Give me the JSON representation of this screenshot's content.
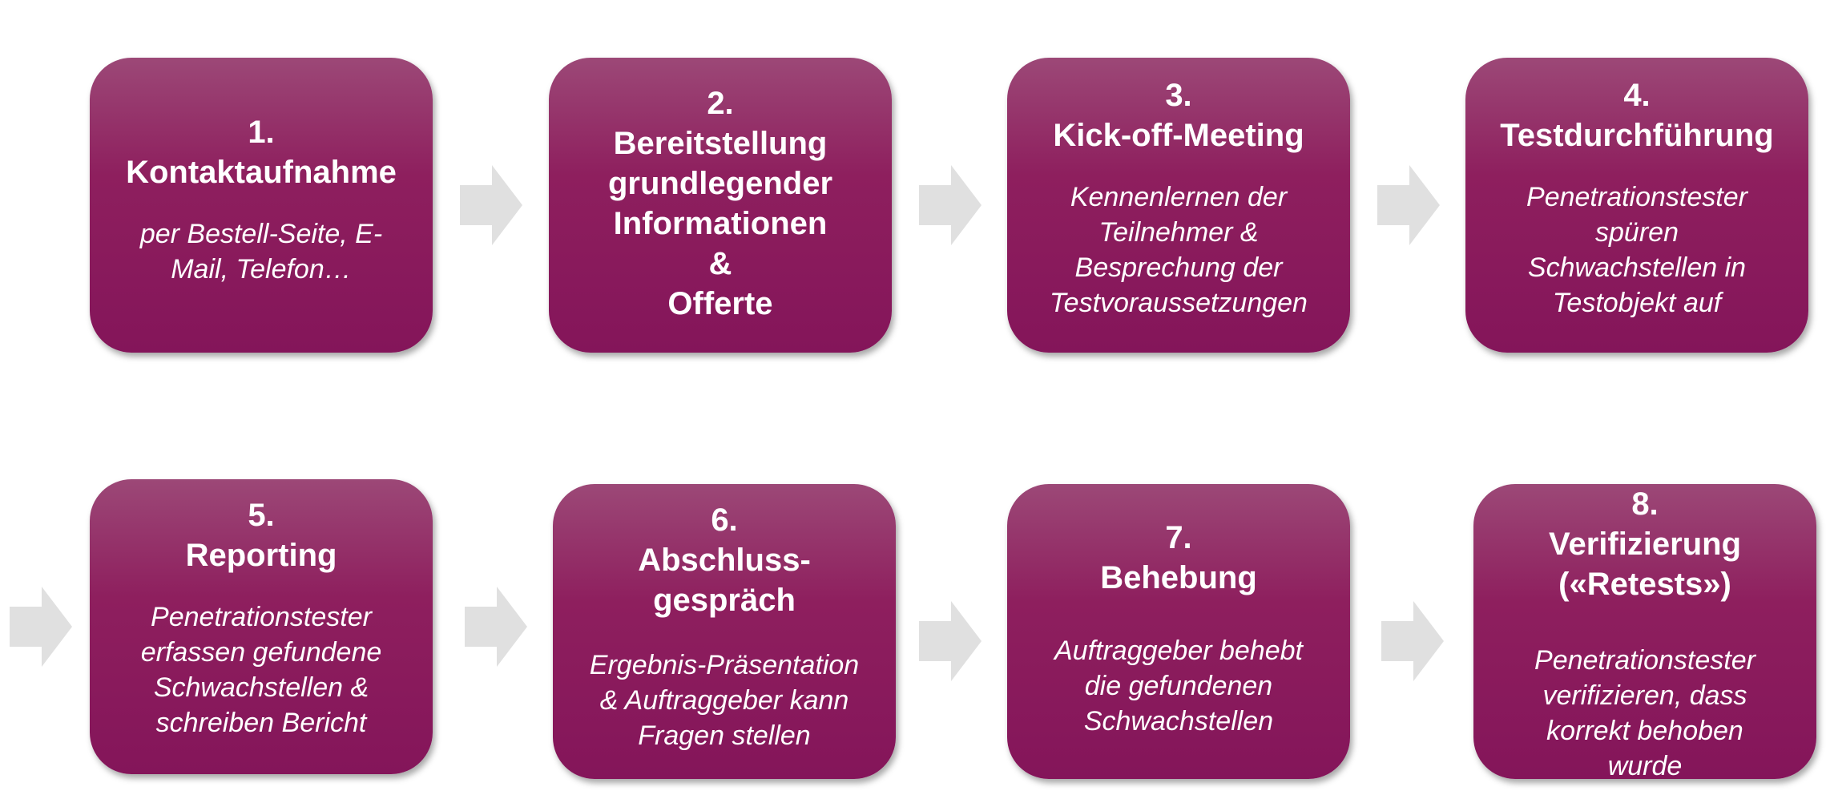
{
  "colors": {
    "box_top": "#9c4877",
    "box_bottom": "#84155a",
    "arrow": "#e0e0e0",
    "text": "#ffffff"
  },
  "steps": [
    {
      "title": "1.\nKontaktaufnahme",
      "description": "per Bestell-Seite, E-\nMail, Telefon…"
    },
    {
      "title": "2.\nBereitstellung\ngrundlegender\nInformationen\n&\nOfferte",
      "description": ""
    },
    {
      "title": "3.\nKick-off-Meeting",
      "description": "Kennenlernen der\nTeilnehmer &\nBesprechung der\nTestvoraussetzungen"
    },
    {
      "title": "4.\nTestdurchführung",
      "description": "Penetrationstester\nspüren\nSchwachstellen in\nTestobjekt auf"
    },
    {
      "title": "5.\nReporting",
      "description": "Penetrationstester\nerfassen gefundene\nSchwachstellen &\nschreiben Bericht"
    },
    {
      "title": "6.\nAbschluss-\ngespräch",
      "description": "Ergebnis-Präsentation\n& Auftraggeber kann\nFragen stellen"
    },
    {
      "title": "7.\nBehebung",
      "description": "Auftraggeber behebt\ndie gefundenen\nSchwachstellen"
    },
    {
      "title": "8.\nVerifizierung\n(«Retests»)",
      "description": "Penetrationstester\nverifizieren, dass\nkorrekt behoben\nwurde"
    }
  ]
}
